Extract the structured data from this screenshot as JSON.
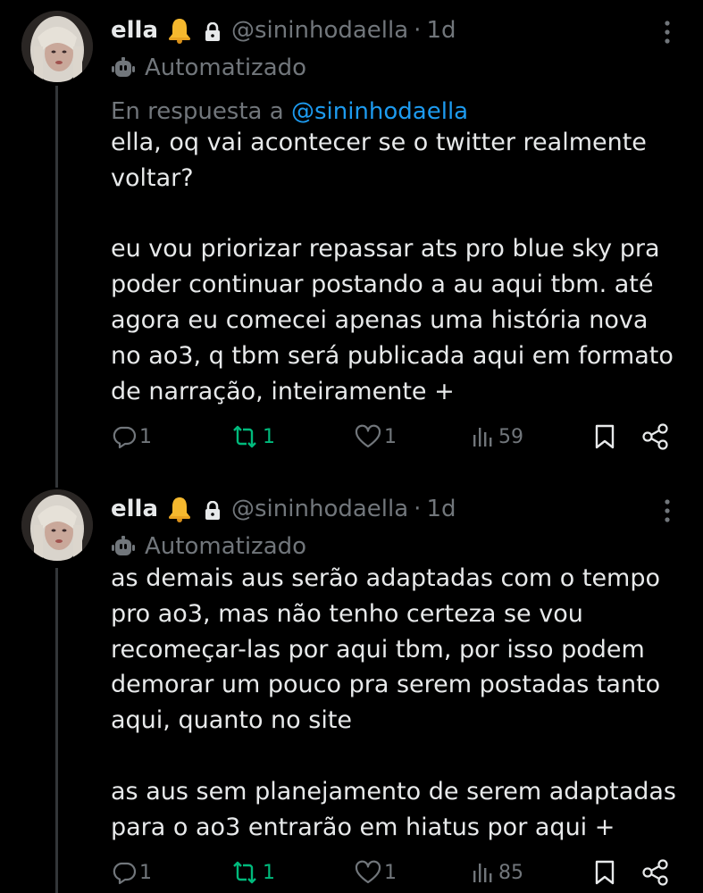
{
  "tweets": [
    {
      "display_name": "ella",
      "handle": "@sininhodaella",
      "separator": "·",
      "time": "1d",
      "automated_label": "Automatizado",
      "reply_prefix": "En respuesta a",
      "reply_to": "@sininhodaella",
      "text": "ella, oq vai acontecer se o twitter realmente\nvoltar?\n\neu vou priorizar repassar ats pro blue sky pra\npoder continuar postando a au aqui tbm. até\nagora eu comecei apenas uma história nova\nno ao3, q tbm será publicada aqui em formato\nde narração, inteiramente +",
      "replies": "1",
      "reposts": "1",
      "likes": "1",
      "views": "59"
    },
    {
      "display_name": "ella",
      "handle": "@sininhodaella",
      "separator": "·",
      "time": "1d",
      "automated_label": "Automatizado",
      "text": "as demais aus serão adaptadas com o tempo\npro ao3, mas não tenho certeza se vou\nrecomeçar-las por aqui tbm, por isso podem\ndemorar um pouco pra serem postadas tanto\naqui, quanto no site\n\nas aus sem planejamento de serem adaptadas\npara o ao3 entrarão em hiatus por aqui +",
      "replies": "1",
      "reposts": "1",
      "likes": "1",
      "views": "85"
    }
  ],
  "colors": {
    "background": "#000000",
    "text": "#e7e9ea",
    "muted": "#71767b",
    "link": "#1d9bf0",
    "repost_active": "#00ba7c",
    "thread_line": "#333639"
  },
  "icons": [
    "bell-icon",
    "lock-icon",
    "more-icon",
    "bot-icon",
    "reply-icon",
    "repost-icon",
    "like-icon",
    "views-icon",
    "bookmark-icon",
    "share-icon"
  ]
}
